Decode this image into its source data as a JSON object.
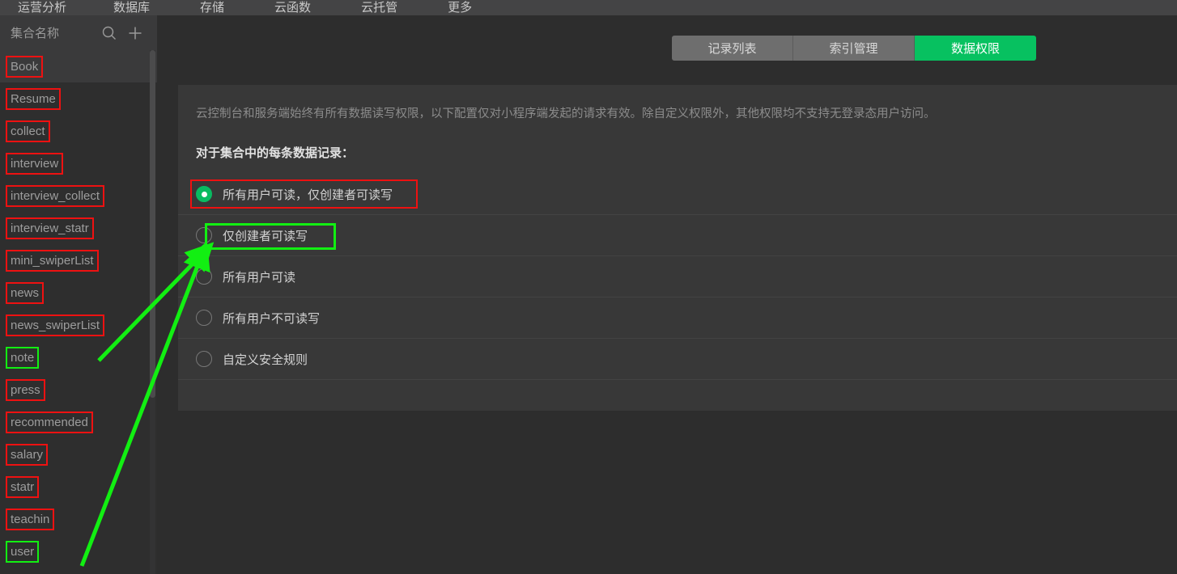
{
  "topnav": {
    "items": [
      {
        "label": "运营分析"
      },
      {
        "label": "数据库"
      },
      {
        "label": "存储"
      },
      {
        "label": "云函数"
      },
      {
        "label": "云托管"
      },
      {
        "label": "更多"
      }
    ]
  },
  "sidebar": {
    "title": "集合名称",
    "search_icon": "search-icon",
    "add_icon": "plus-icon",
    "collections": [
      {
        "label": "Book",
        "selected": true,
        "annotation": "red"
      },
      {
        "label": "Resume",
        "selected": false,
        "annotation": "red"
      },
      {
        "label": "collect",
        "selected": false,
        "annotation": "red"
      },
      {
        "label": "interview",
        "selected": false,
        "annotation": "red"
      },
      {
        "label": "interview_collect",
        "selected": false,
        "annotation": "red"
      },
      {
        "label": "interview_statr",
        "selected": false,
        "annotation": "red"
      },
      {
        "label": "mini_swiperList",
        "selected": false,
        "annotation": "red"
      },
      {
        "label": "news",
        "selected": false,
        "annotation": "red"
      },
      {
        "label": "news_swiperList",
        "selected": false,
        "annotation": "red"
      },
      {
        "label": "note",
        "selected": false,
        "annotation": "green"
      },
      {
        "label": "press",
        "selected": false,
        "annotation": "red"
      },
      {
        "label": "recommended",
        "selected": false,
        "annotation": "red"
      },
      {
        "label": "salary",
        "selected": false,
        "annotation": "red"
      },
      {
        "label": "statr",
        "selected": false,
        "annotation": "red"
      },
      {
        "label": "teachin",
        "selected": false,
        "annotation": "red"
      },
      {
        "label": "user",
        "selected": false,
        "annotation": "green"
      }
    ]
  },
  "main": {
    "tabs": [
      {
        "label": "记录列表",
        "active": false
      },
      {
        "label": "索引管理",
        "active": false
      },
      {
        "label": "数据权限",
        "active": true
      }
    ],
    "description": "云控制台和服务端始终有所有数据读写权限，以下配置仅对小程序端发起的请求有效。除自定义权限外，其他权限均不支持无登录态用户访问。",
    "subtitle": "对于集合中的每条数据记录：",
    "options": [
      {
        "label": "所有用户可读，仅创建者可读写",
        "checked": true,
        "annotation": "red"
      },
      {
        "label": "仅创建者可读写",
        "checked": false,
        "annotation": "green"
      },
      {
        "label": "所有用户可读",
        "checked": false,
        "annotation": "none"
      },
      {
        "label": "所有用户不可读写",
        "checked": false,
        "annotation": "none"
      },
      {
        "label": "自定义安全规则",
        "checked": false,
        "annotation": "none"
      }
    ]
  },
  "colors": {
    "accent_green": "#07c160",
    "radio_green": "#09bb61",
    "annotation_red": "#ee1111",
    "annotation_green": "#12ef12",
    "page_bg": "#2d2d2d",
    "panel_bg": "#383838",
    "sidebar_bg": "#2e2e2e"
  }
}
